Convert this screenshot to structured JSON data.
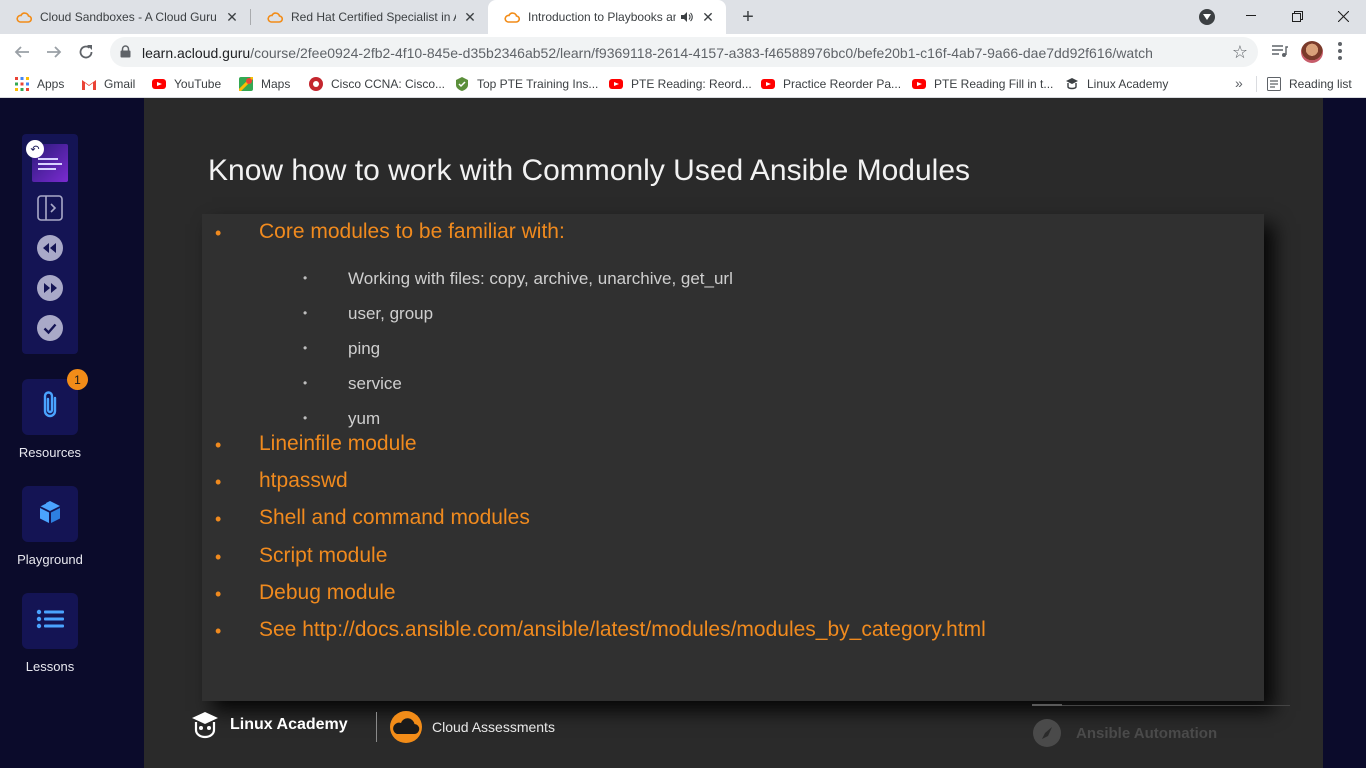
{
  "browser": {
    "tabs": [
      {
        "title": "Cloud Sandboxes - A Cloud Guru",
        "active": false
      },
      {
        "title": "Red Hat Certified Specialist in An",
        "active": false
      },
      {
        "title": "Introduction to Playbooks an",
        "active": true
      }
    ],
    "url_host": "learn.acloud.guru",
    "url_path": "/course/2fee0924-2fb2-4f10-845e-d35b2346ab52/learn/f9369118-2614-4157-a383-f46588976bc0/befe20b1-c16f-4ab7-9a66-dae7dd92f616/watch",
    "bookmarks": [
      {
        "label": "Apps",
        "icon": "apps-grid-icon"
      },
      {
        "label": "Gmail",
        "icon": "gmail-icon"
      },
      {
        "label": "YouTube",
        "icon": "youtube-icon"
      },
      {
        "label": "Maps",
        "icon": "maps-icon"
      },
      {
        "label": "Cisco CCNA: Cisco...",
        "icon": "cisco-icon"
      },
      {
        "label": "Top PTE Training Ins...",
        "icon": "pte-icon"
      },
      {
        "label": "PTE Reading: Reord...",
        "icon": "youtube-icon"
      },
      {
        "label": "Practice Reorder Pa...",
        "icon": "youtube-icon"
      },
      {
        "label": "PTE Reading Fill in t...",
        "icon": "youtube-icon"
      },
      {
        "label": "Linux Academy",
        "icon": "linux-academy-icon"
      }
    ],
    "reading_list": "Reading list"
  },
  "sidebar": {
    "resources_label": "Resources",
    "resources_badge": "1",
    "playground_label": "Playground",
    "lessons_label": "Lessons"
  },
  "slide": {
    "title": "Know how to work with Commonly Used Ansible Modules",
    "core_heading": "Core modules to be familiar with:",
    "sub_items": [
      "Working with files: copy, archive, unarchive, get_url",
      "user, group",
      "ping",
      "service",
      "yum"
    ],
    "items": [
      "Lineinfile module",
      "htpasswd",
      "Shell and command modules",
      "Script module",
      "Debug module",
      "See http://docs.ansible.com/ansible/latest/modules/modules_by_category.html"
    ],
    "footer_linux_academy": "Linux Academy",
    "footer_cloud_assessments": "Cloud Assessments",
    "footer_ansible": "Ansible Automation"
  },
  "colors": {
    "accent_orange": "#f08a1e",
    "rail_bg": "#0b0b2b",
    "badge": "#f28c18"
  }
}
